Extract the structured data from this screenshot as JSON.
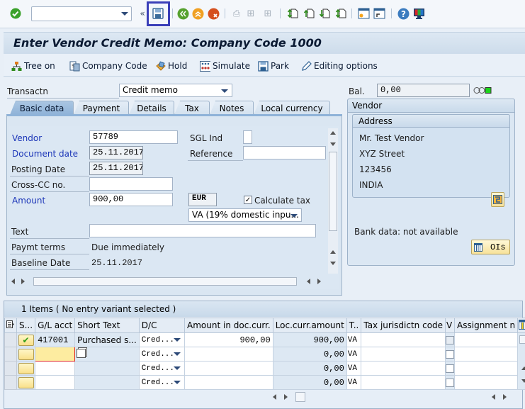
{
  "toolbar": {
    "command_field_value": "",
    "icons": [
      "enter-icon",
      "back-icon",
      "exit-icon",
      "cancel-icon",
      "print-icon",
      "find-icon",
      "find-next-icon",
      "first-page-icon",
      "previous-page-icon",
      "next-page-icon",
      "last-page-icon",
      "new-session-icon",
      "create-shortcut-icon",
      "help-icon",
      "customize-layout-icon"
    ],
    "save_highlight_color": "#3a3fb8"
  },
  "title": "Enter Vendor Credit Memo: Company Code 1000",
  "app_toolbar": {
    "tree_on": "Tree on",
    "company_code": "Company Code",
    "hold": "Hold",
    "simulate": "Simulate",
    "park": "Park",
    "editing_options": "Editing options"
  },
  "header": {
    "transaction_label": "Transactn",
    "transaction_value": "Credit memo",
    "balance_label": "Bal.",
    "balance_value": "0,00",
    "status_light": "green"
  },
  "tabs": [
    {
      "label": "Basic data",
      "active": true
    },
    {
      "label": "Payment",
      "active": false
    },
    {
      "label": "Details",
      "active": false
    },
    {
      "label": "Tax",
      "active": false
    },
    {
      "label": "Notes",
      "active": false
    },
    {
      "label": "Local currency",
      "active": false
    }
  ],
  "basic_data": {
    "vendor_label": "Vendor",
    "vendor_value": "57789",
    "sgl_label": "SGL Ind",
    "sgl_value": "",
    "doc_date_label": "Document date",
    "doc_date_value": "25.11.2017",
    "reference_label": "Reference",
    "reference_value": "",
    "posting_date_label": "Posting Date",
    "posting_date_value": "25.11.2017",
    "cross_cc_label": "Cross-CC no.",
    "cross_cc_value": "",
    "amount_label": "Amount",
    "amount_value": "900,00",
    "currency_value": "EUR",
    "calc_tax_label": "Calculate tax",
    "calc_tax_checked": true,
    "tax_code_value": "VA (19% domestic inpu...",
    "text_label": "Text",
    "text_value": "",
    "paymt_terms_label": "Paymt terms",
    "paymt_terms_value": "Due immediately",
    "baseline_label": "Baseline Date",
    "baseline_value": "25.11.2017"
  },
  "vendor": {
    "title": "Vendor",
    "address_title": "Address",
    "address_lines": [
      "Mr. Test Vendor",
      "XYZ Street",
      "123456",
      "INDIA"
    ],
    "bank_data": "Bank data: not available",
    "ois_button": "OIs"
  },
  "items": {
    "title": "1 Items ( No entry variant selected )",
    "columns": [
      "S...",
      "G/L acct",
      "Short Text",
      "D/C",
      "Amount in doc.curr.",
      "Loc.curr.amount",
      "T..",
      "Tax jurisdictn code",
      "V",
      "Assignment n"
    ],
    "rows": [
      {
        "status": "ok",
        "gl": "417001",
        "short_text": "Purchased s...",
        "dc": "Cred...",
        "amount_doc": "900,00",
        "amount_loc": "900,00",
        "tax": "VA",
        "jurisdiction": "",
        "assignment": ""
      },
      {
        "status": "",
        "gl": "",
        "short_text": "",
        "dc": "Cred...",
        "amount_doc": "",
        "amount_loc": "0,00",
        "tax": "VA",
        "jurisdiction": "",
        "assignment": ""
      },
      {
        "status": "",
        "gl": "",
        "short_text": "",
        "dc": "Cred...",
        "amount_doc": "",
        "amount_loc": "0,00",
        "tax": "VA",
        "jurisdiction": "",
        "assignment": ""
      },
      {
        "status": "",
        "gl": "",
        "short_text": "",
        "dc": "Cred...",
        "amount_doc": "",
        "amount_loc": "0,00",
        "tax": "VA",
        "jurisdiction": "",
        "assignment": ""
      }
    ]
  }
}
